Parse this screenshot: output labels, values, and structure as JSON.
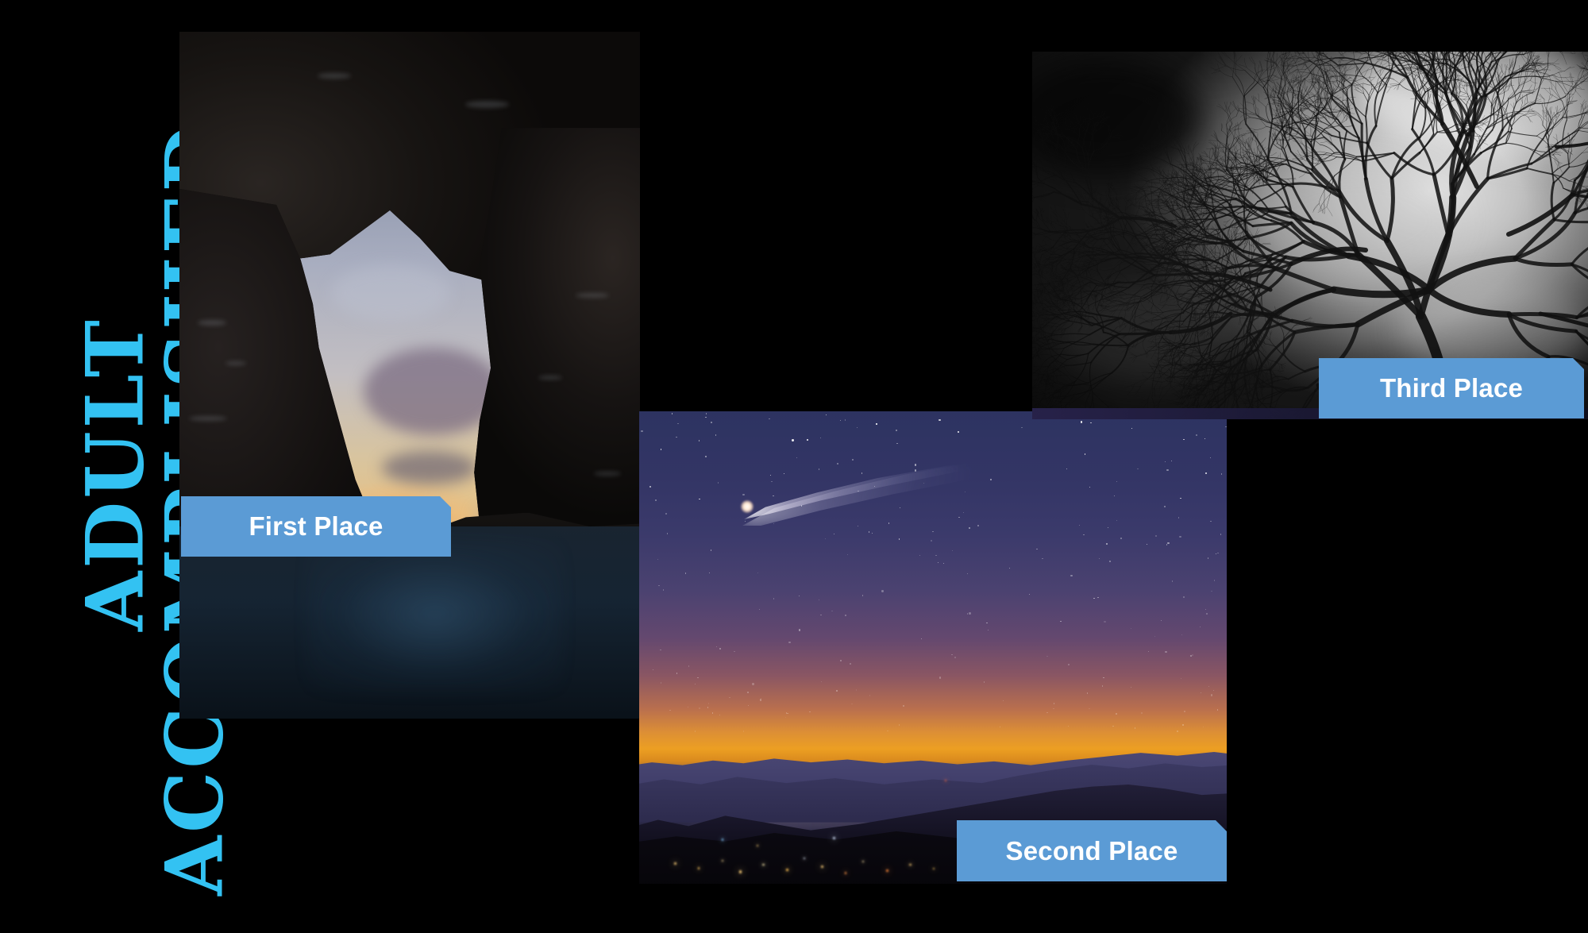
{
  "slide": {
    "background_color": "#000000",
    "title": {
      "line1": "ADULT",
      "line2": "ACCOMPLISHED",
      "color": "#33C2F2",
      "orientation": "vertical-rotated-90-ccw"
    },
    "badge_color": "#5B9BD5",
    "badge_text_color": "#FFFFFF"
  },
  "entries": [
    {
      "rank": "first",
      "badge_label": "First Place",
      "photo_name": "sea-cave-sunset-photo",
      "photo_description": "Sunset over the ocean framed by a dark sea cave opening",
      "palette": {
        "sky": "#C3BFC2",
        "sun": "#FFC451",
        "rock": "#0D0C0D",
        "water": "#1A2836"
      }
    },
    {
      "rank": "second",
      "badge_label": "Second Place",
      "photo_name": "comet-over-mountains-photo",
      "photo_description": "Comet with a bright tail above silhouetted mountain ridges at twilight",
      "palette": {
        "sky_top": "#2D3361",
        "horizon": "#EC9F22",
        "ridge": "#12101F",
        "comet": "#FFFFFF"
      }
    },
    {
      "rank": "third",
      "badge_label": "Third Place",
      "photo_name": "bare-tree-blackandwhite-photo",
      "photo_description": "Black and white upward view of a bare tree canopy against a bright cloudy sky",
      "palette": {
        "sky_light": "#E6E6E6",
        "sky_dark": "#0A0A0A",
        "branches": "#141414"
      }
    }
  ]
}
